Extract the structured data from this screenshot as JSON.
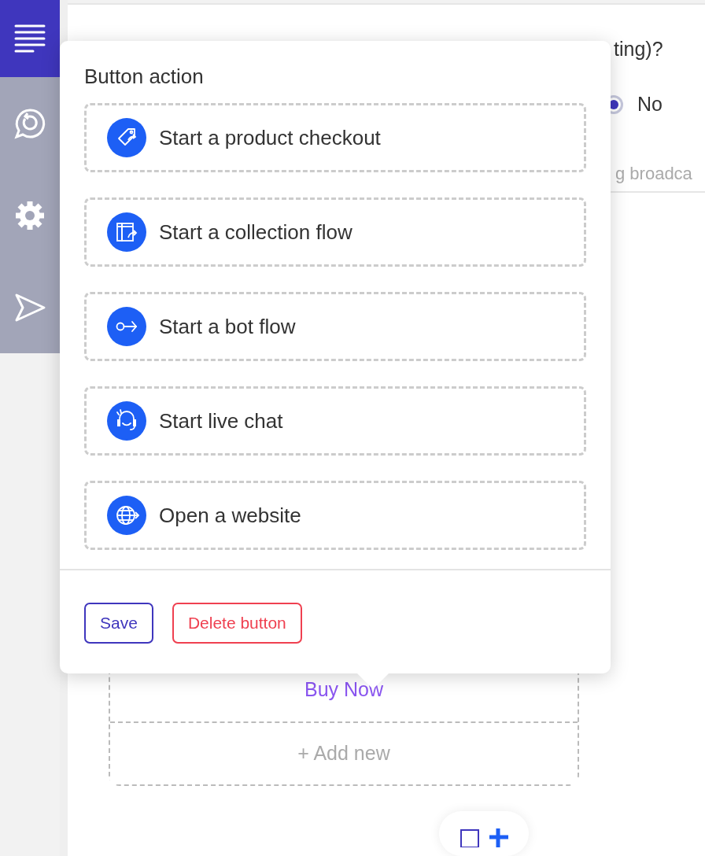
{
  "sidebar": {
    "items": [
      {
        "kind": "menu",
        "selected": true
      },
      {
        "kind": "chat",
        "selected": false
      },
      {
        "kind": "settings",
        "selected": false
      },
      {
        "kind": "send",
        "selected": false
      }
    ]
  },
  "background": {
    "question_tail": "ting)?",
    "radio": {
      "label": "No",
      "selected": true
    },
    "hint": "g broadca",
    "message_buttons": [
      {
        "label": "Buy Now",
        "kind": "button"
      },
      {
        "label": "+ Add new",
        "kind": "add"
      }
    ]
  },
  "popover": {
    "title": "Button action",
    "actions": [
      {
        "label": "Start a product checkout",
        "kind": "checkout"
      },
      {
        "label": "Start a collection flow",
        "kind": "collection"
      },
      {
        "label": "Start a bot flow",
        "kind": "bot"
      },
      {
        "label": "Start live chat",
        "kind": "livechat"
      },
      {
        "label": "Open a website",
        "kind": "website"
      }
    ],
    "buttons": [
      {
        "label": "Save",
        "kind": "save"
      },
      {
        "label": "Delete button",
        "kind": "delete"
      }
    ]
  }
}
